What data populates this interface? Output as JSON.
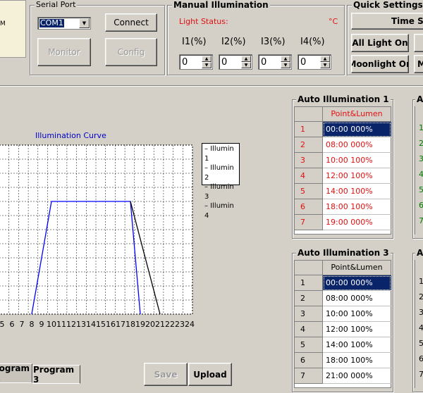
{
  "left_stub_text": "M",
  "serial_port": {
    "title": "Serial Port",
    "port_value": "COM1",
    "connect_label": "Connect",
    "monitor_label": "Monitor",
    "config_label": "Config"
  },
  "manual": {
    "title": "Manual Illumination",
    "status_label": "Light Status:",
    "temp_unit": "°C",
    "channels": [
      {
        "label": "I1(%)",
        "value": "0"
      },
      {
        "label": "I2(%)",
        "value": "0"
      },
      {
        "label": "I3(%)",
        "value": "0"
      },
      {
        "label": "I4(%)",
        "value": "0"
      }
    ]
  },
  "quick": {
    "title": "Quick Settings",
    "time_sync_label": "Time Sy",
    "all_light_on_label": "All Light On",
    "moonlight_on_label": "Moonlight On",
    "cut_button_label": "M"
  },
  "chart_data": {
    "type": "line",
    "title": "Illumination Curve",
    "x_ticks": [
      "5",
      "6",
      "7",
      "8",
      "9",
      "10",
      "11",
      "12",
      "13",
      "14",
      "15",
      "16",
      "17",
      "18",
      "19",
      "20",
      "21",
      "22",
      "23",
      "24"
    ],
    "xlim": [
      5,
      24
    ],
    "ylim": [
      0,
      100
    ],
    "grid": true,
    "legend_placement": "right",
    "series": [
      {
        "name": "Illumin 1",
        "color": "#0000ff",
        "x": [
          8,
          10,
          18,
          19
        ],
        "y": [
          0,
          100,
          100,
          0
        ]
      },
      {
        "name": "Illumin 2",
        "color": "#000000",
        "x": [
          18,
          21
        ],
        "y": [
          100,
          0
        ]
      },
      {
        "name": "Illumin 3",
        "color": "#000000",
        "x": [],
        "y": []
      },
      {
        "name": "Illumin 4",
        "color": "#000000",
        "x": [],
        "y": []
      }
    ]
  },
  "auto1": {
    "title": "Auto Illumination 1",
    "header": "Point&Lumen",
    "rows": [
      {
        "n": "1",
        "v": "00:00  000%"
      },
      {
        "n": "2",
        "v": "08:00  000%"
      },
      {
        "n": "3",
        "v": "10:00  100%"
      },
      {
        "n": "4",
        "v": "12:00  100%"
      },
      {
        "n": "5",
        "v": "14:00  100%"
      },
      {
        "n": "6",
        "v": "18:00  100%"
      },
      {
        "n": "7",
        "v": "19:00  000%"
      }
    ]
  },
  "auto3": {
    "title": "Auto Illumination 3",
    "header": "Point&Lumen",
    "rows": [
      {
        "n": "1",
        "v": "00:00  000%"
      },
      {
        "n": "2",
        "v": "08:00  000%"
      },
      {
        "n": "3",
        "v": "10:00  100%"
      },
      {
        "n": "4",
        "v": "12:00  100%"
      },
      {
        "n": "5",
        "v": "14:00  100%"
      },
      {
        "n": "6",
        "v": "18:00  100%"
      },
      {
        "n": "7",
        "v": "21:00  000%"
      }
    ]
  },
  "right_cut": {
    "title_a": "A",
    "title_b": "A",
    "digits_top": [
      "1",
      "2",
      "3",
      "4",
      "5",
      "6",
      "7"
    ],
    "digits_bottom": [
      "1",
      "2",
      "3",
      "4",
      "5",
      "6",
      "7"
    ]
  },
  "tabs": {
    "program2": "rogram 2",
    "program3": "Program 3"
  },
  "actions": {
    "save_label": "Save",
    "upload_label": "Upload"
  },
  "colors": {
    "accent_red": "#e01010",
    "selection": "#0a246a",
    "curve_blue": "#0000ff"
  }
}
